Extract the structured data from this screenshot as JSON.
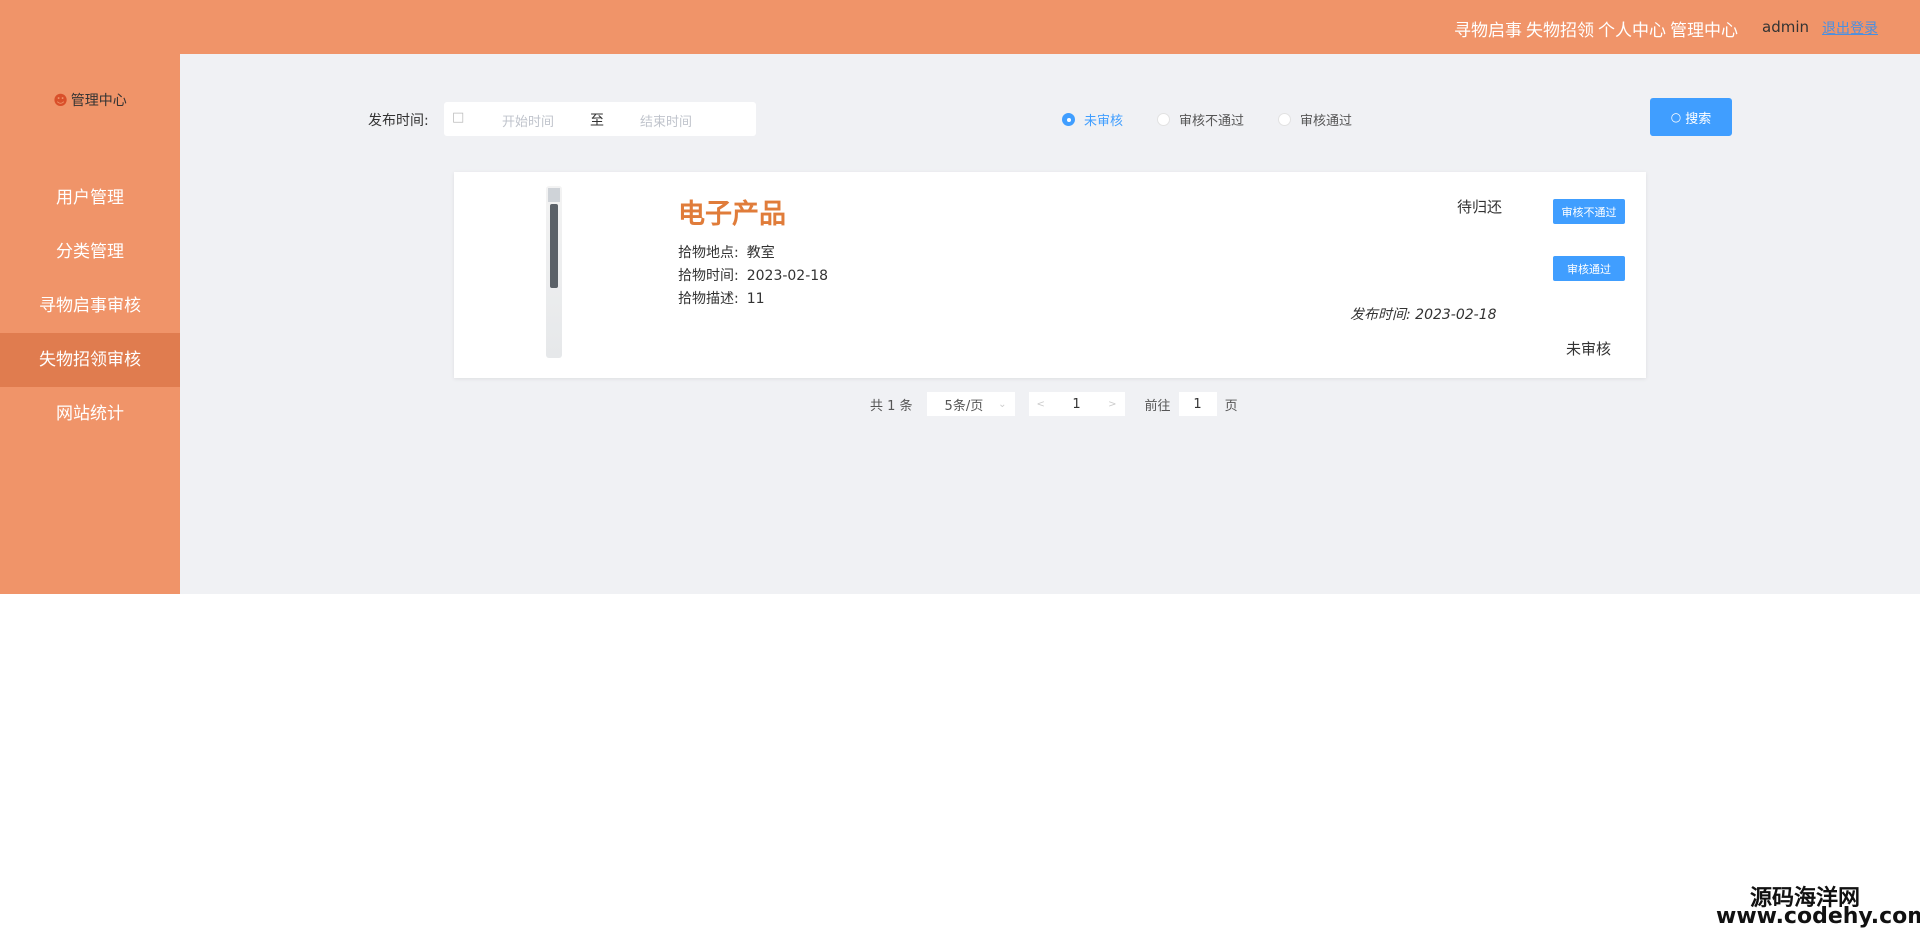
{
  "topbar": {
    "nav": [
      "寻物启事",
      "失物招领",
      "个人中心",
      "管理中心"
    ],
    "user": "admin",
    "logout": "退出登录"
  },
  "sidebar": {
    "title": "管理中心",
    "items": [
      {
        "label": "用户管理"
      },
      {
        "label": "分类管理"
      },
      {
        "label": "寻物启事审核"
      },
      {
        "label": "失物招领审核",
        "active": true
      },
      {
        "label": "网站统计"
      }
    ]
  },
  "filter": {
    "label": "发布时间:",
    "start_placeholder": "开始时间",
    "separator": "至",
    "end_placeholder": "结束时间",
    "radios": [
      {
        "label": "未审核",
        "checked": true
      },
      {
        "label": "审核不通过",
        "checked": false
      },
      {
        "label": "审核通过",
        "checked": false
      }
    ],
    "search_label": "搜索"
  },
  "item": {
    "title": "电子产品",
    "location_label": "拾物地点:",
    "location": "教室",
    "time_label": "拾物时间:",
    "time": "2023-02-18",
    "desc_label": "拾物描述:",
    "desc": "11",
    "status": "待归还",
    "publish_label": "发布时间:",
    "publish_time": "2023-02-18",
    "audit_status": "未审核",
    "reject_label": "审核不通过",
    "approve_label": "审核通过"
  },
  "pagination": {
    "total_text": "共 1 条",
    "page_size": "5条/页",
    "current_page": "1",
    "goto_label": "前往",
    "goto_value": "1",
    "page_suffix": "页"
  },
  "watermark": {
    "line1": "源码海洋网",
    "line2": "www.codehy.com"
  },
  "colors": {
    "accent": "#f09469",
    "active_item": "#e07c4f",
    "primary": "#409eff",
    "title": "#e07c3a"
  }
}
